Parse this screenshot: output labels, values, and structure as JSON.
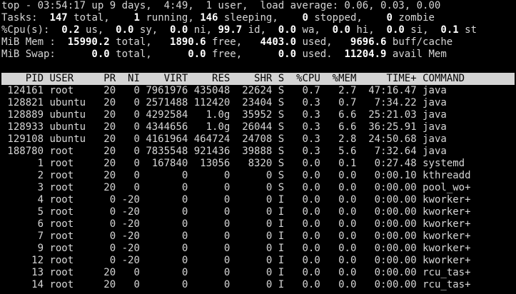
{
  "summary": {
    "uptime_line": {
      "prefix": "top - 03:54:17 up 9 days,  4:49,  1 user,  load average: 0.06, 0.03, 0.00"
    },
    "tasks": {
      "label": "Tasks:",
      "total": "147",
      "total_label": " total,",
      "running": "1",
      "running_label": " running,",
      "sleeping": "146",
      "sleeping_label": " sleeping,",
      "stopped": "0",
      "stopped_label": " stopped,",
      "zombie": "0",
      "zombie_label": " zombie"
    },
    "cpu": {
      "label": "%Cpu(s):",
      "us": "0.2",
      "us_label": " us,",
      "sy": "0.0",
      "sy_label": " sy,",
      "ni": "0.0",
      "ni_label": " ni,",
      "id": "99.7",
      "id_label": " id,",
      "wa": "0.0",
      "wa_label": " wa,",
      "hi": "0.0",
      "hi_label": " hi,",
      "si": "0.0",
      "si_label": " si,",
      "st": "0.1",
      "st_label": " st"
    },
    "mem": {
      "label": "MiB Mem :",
      "total": "15990.2",
      "total_label": " total,",
      "free": "1890.6",
      "free_label": " free,",
      "used": "4403.0",
      "used_label": " used,",
      "buff": "9696.6",
      "buff_label": " buff/cache"
    },
    "swap": {
      "label": "MiB Swap:",
      "total": "0.0",
      "total_label": " total,",
      "free": "0.0",
      "free_label": " free,",
      "used": "0.0",
      "used_label": " used.",
      "avail": "11204.9",
      "avail_label": " avail Mem"
    }
  },
  "columns": [
    "PID",
    "USER",
    "PR",
    "NI",
    "VIRT",
    "RES",
    "SHR",
    "S",
    "%CPU",
    "%MEM",
    "TIME+",
    "COMMAND"
  ],
  "processes": [
    {
      "pid": "124161",
      "user": "root",
      "pr": "20",
      "ni": "0",
      "virt": "7961976",
      "res": "435048",
      "shr": "22624",
      "s": "S",
      "cpu": "0.7",
      "mem": "2.7",
      "time": "47:16.47",
      "cmd": "java"
    },
    {
      "pid": "128821",
      "user": "ubuntu",
      "pr": "20",
      "ni": "0",
      "virt": "2571488",
      "res": "112420",
      "shr": "23404",
      "s": "S",
      "cpu": "0.3",
      "mem": "0.7",
      "time": "7:34.22",
      "cmd": "java"
    },
    {
      "pid": "128889",
      "user": "ubuntu",
      "pr": "20",
      "ni": "0",
      "virt": "4292584",
      "res": "1.0g",
      "shr": "35952",
      "s": "S",
      "cpu": "0.3",
      "mem": "6.6",
      "time": "25:21.03",
      "cmd": "java"
    },
    {
      "pid": "128933",
      "user": "ubuntu",
      "pr": "20",
      "ni": "0",
      "virt": "4344656",
      "res": "1.0g",
      "shr": "26044",
      "s": "S",
      "cpu": "0.3",
      "mem": "6.6",
      "time": "36:25.91",
      "cmd": "java"
    },
    {
      "pid": "129108",
      "user": "ubuntu",
      "pr": "20",
      "ni": "0",
      "virt": "4161964",
      "res": "464724",
      "shr": "24708",
      "s": "S",
      "cpu": "0.3",
      "mem": "2.8",
      "time": "24:50.68",
      "cmd": "java"
    },
    {
      "pid": "188780",
      "user": "root",
      "pr": "20",
      "ni": "0",
      "virt": "7835548",
      "res": "921436",
      "shr": "39888",
      "s": "S",
      "cpu": "0.3",
      "mem": "5.6",
      "time": "7:32.64",
      "cmd": "java"
    },
    {
      "pid": "1",
      "user": "root",
      "pr": "20",
      "ni": "0",
      "virt": "167840",
      "res": "13056",
      "shr": "8320",
      "s": "S",
      "cpu": "0.0",
      "mem": "0.1",
      "time": "0:27.48",
      "cmd": "systemd"
    },
    {
      "pid": "2",
      "user": "root",
      "pr": "20",
      "ni": "0",
      "virt": "0",
      "res": "0",
      "shr": "0",
      "s": "S",
      "cpu": "0.0",
      "mem": "0.0",
      "time": "0:00.10",
      "cmd": "kthreadd"
    },
    {
      "pid": "3",
      "user": "root",
      "pr": "20",
      "ni": "0",
      "virt": "0",
      "res": "0",
      "shr": "0",
      "s": "S",
      "cpu": "0.0",
      "mem": "0.0",
      "time": "0:00.00",
      "cmd": "pool_wo+"
    },
    {
      "pid": "4",
      "user": "root",
      "pr": "0",
      "ni": "-20",
      "virt": "0",
      "res": "0",
      "shr": "0",
      "s": "I",
      "cpu": "0.0",
      "mem": "0.0",
      "time": "0:00.00",
      "cmd": "kworker+"
    },
    {
      "pid": "5",
      "user": "root",
      "pr": "0",
      "ni": "-20",
      "virt": "0",
      "res": "0",
      "shr": "0",
      "s": "I",
      "cpu": "0.0",
      "mem": "0.0",
      "time": "0:00.00",
      "cmd": "kworker+"
    },
    {
      "pid": "6",
      "user": "root",
      "pr": "0",
      "ni": "-20",
      "virt": "0",
      "res": "0",
      "shr": "0",
      "s": "I",
      "cpu": "0.0",
      "mem": "0.0",
      "time": "0:00.00",
      "cmd": "kworker+"
    },
    {
      "pid": "7",
      "user": "root",
      "pr": "0",
      "ni": "-20",
      "virt": "0",
      "res": "0",
      "shr": "0",
      "s": "I",
      "cpu": "0.0",
      "mem": "0.0",
      "time": "0:00.00",
      "cmd": "kworker+"
    },
    {
      "pid": "9",
      "user": "root",
      "pr": "0",
      "ni": "-20",
      "virt": "0",
      "res": "0",
      "shr": "0",
      "s": "I",
      "cpu": "0.0",
      "mem": "0.0",
      "time": "0:00.00",
      "cmd": "kworker+"
    },
    {
      "pid": "12",
      "user": "root",
      "pr": "0",
      "ni": "-20",
      "virt": "0",
      "res": "0",
      "shr": "0",
      "s": "I",
      "cpu": "0.0",
      "mem": "0.0",
      "time": "0:00.00",
      "cmd": "kworker+"
    },
    {
      "pid": "13",
      "user": "root",
      "pr": "20",
      "ni": "0",
      "virt": "0",
      "res": "0",
      "shr": "0",
      "s": "I",
      "cpu": "0.0",
      "mem": "0.0",
      "time": "0:00.00",
      "cmd": "rcu_tas+"
    },
    {
      "pid": "14",
      "user": "root",
      "pr": "20",
      "ni": "0",
      "virt": "0",
      "res": "0",
      "shr": "0",
      "s": "I",
      "cpu": "0.0",
      "mem": "0.0",
      "time": "0:00.00",
      "cmd": "rcu_tas+"
    }
  ]
}
